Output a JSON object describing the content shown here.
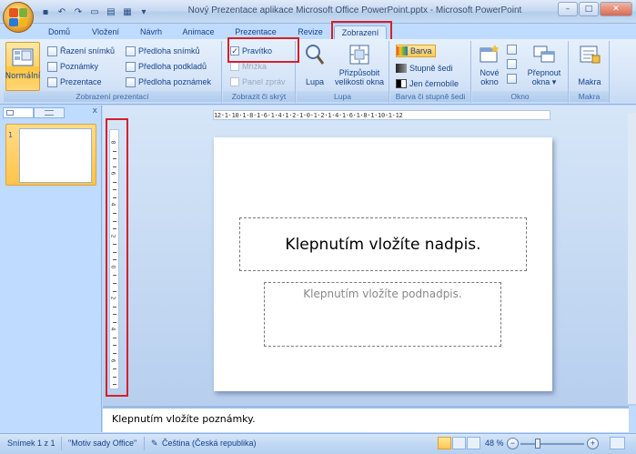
{
  "window": {
    "title": "Nový Prezentace aplikace Microsoft Office PowerPoint.pptx - Microsoft PowerPoint",
    "controls": {
      "minimize": "–",
      "maximize": "□",
      "close": "✕"
    }
  },
  "quick_access": {
    "save_icon": "▪",
    "undo_icon": "↶",
    "redo_icon": "↷",
    "new_icon": "▭",
    "open_icon": "▤",
    "print_icon": "▦",
    "more_icon": "▾"
  },
  "tabs": [
    {
      "label": "Domů"
    },
    {
      "label": "Vložení"
    },
    {
      "label": "Návrh"
    },
    {
      "label": "Animace"
    },
    {
      "label": "Prezentace"
    },
    {
      "label": "Revize"
    },
    {
      "label": "Zobrazení",
      "active": true
    }
  ],
  "ribbon": {
    "presentation_views": {
      "label": "Zobrazení prezentací",
      "normal": "Normální",
      "slide_sorter": "Řazení snímků",
      "notes_page": "Poznámky",
      "slide_show": "Prezentace",
      "slide_master": "Předloha snímků",
      "handout_master": "Předloha podkladů",
      "notes_master": "Předloha poznámek"
    },
    "show_hide": {
      "label": "Zobrazit či skrýt",
      "ruler": "Pravítko",
      "ruler_checked": true,
      "gridlines": "Mřížka",
      "message_bar": "Panel zpráv"
    },
    "zoom": {
      "label": "Lupa",
      "zoom": "Lupa",
      "fit_line1": "Přizpůsobit",
      "fit_line2": "velikosti okna"
    },
    "color": {
      "label": "Barva či stupně šedi",
      "color": "Barva",
      "grayscale": "Stupně šedi",
      "bw": "Jen černobíle"
    },
    "window": {
      "label": "Okno",
      "new_line1": "Nové",
      "new_line2": "okno",
      "switch_line1": "Přepnout",
      "switch_line2": "okna ▾"
    },
    "macros": {
      "label": "Makra",
      "macros": "Makra"
    }
  },
  "left_panel": {
    "close": "x",
    "slide_number": "1"
  },
  "ruler": {
    "horizontal": "12·1·10·1·8·1·6·1·4·1·2·1·0·1·2·1·4·1·6·1·8·1·10·1·12",
    "vertical_labels": [
      "8",
      "6",
      "4",
      "2",
      "0",
      "2",
      "4",
      "6",
      "8"
    ]
  },
  "slide": {
    "title_placeholder": "Klepnutím vložíte nadpis.",
    "subtitle_placeholder": "Klepnutím vložíte podnadpis."
  },
  "notes": {
    "placeholder": "Klepnutím vložíte poznámky."
  },
  "status": {
    "slide": "Snímek 1 z 1",
    "theme": "\"Motiv sady Office\"",
    "language": "Čeština (Česká republika)",
    "zoom": "48 %",
    "zoom_out": "−",
    "zoom_in": "+"
  },
  "highlight_color": "#d6202b"
}
